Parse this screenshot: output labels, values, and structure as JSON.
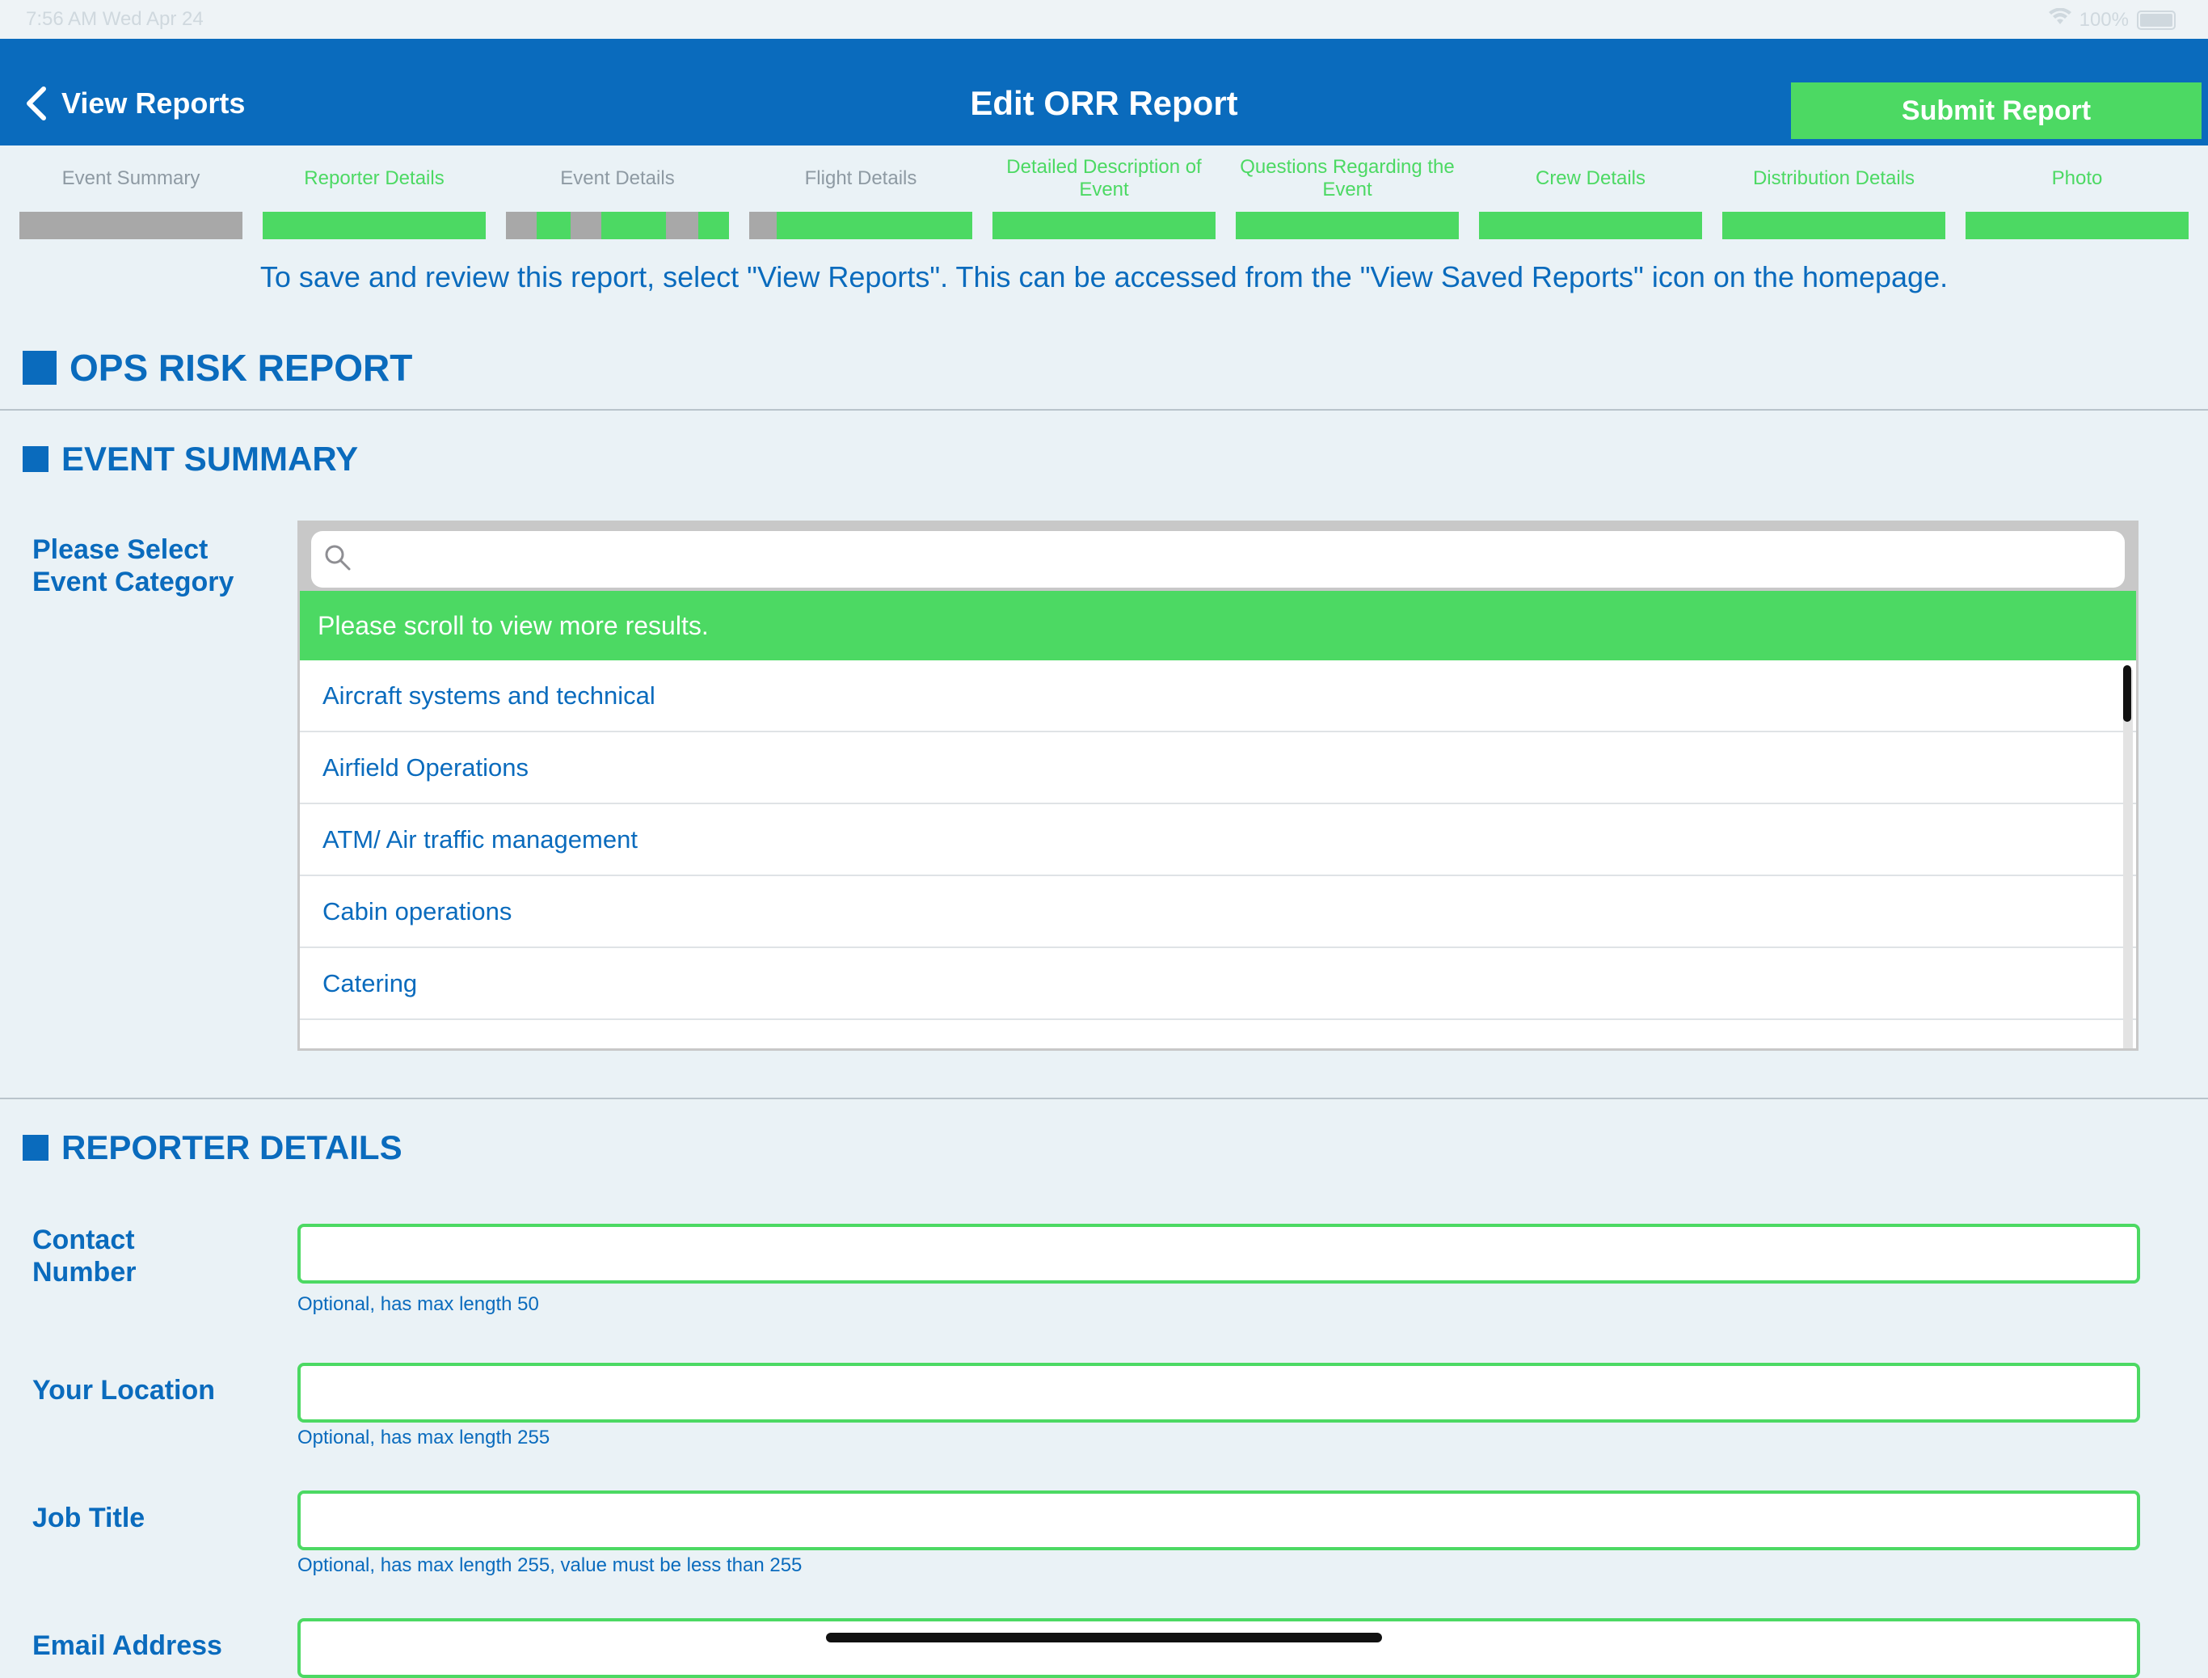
{
  "status_bar": {
    "time": "7:56 AM  Wed Apr 24",
    "battery": "100%"
  },
  "nav": {
    "back_label": "View Reports",
    "title": "Edit ORR Report",
    "submit_label": "Submit Report"
  },
  "steps": [
    {
      "label": "Event Summary",
      "status": "incomplete"
    },
    {
      "label": "Reporter Details",
      "status": "complete"
    },
    {
      "label": "Event Details",
      "status": "partial"
    },
    {
      "label": "Flight Details",
      "status": "partial"
    },
    {
      "label": "Detailed Description of Event",
      "status": "complete"
    },
    {
      "label": "Questions Regarding the Event",
      "status": "complete"
    },
    {
      "label": "Crew Details",
      "status": "complete"
    },
    {
      "label": "Distribution Details",
      "status": "complete"
    },
    {
      "label": "Photo",
      "status": "complete"
    }
  ],
  "notice": "To save and review this report, select \"View Reports\". This can be accessed from the \"View Saved Reports\" icon on the homepage.",
  "report_title": "OPS RISK REPORT",
  "event_summary": {
    "title": "EVENT SUMMARY",
    "category_label": "Please Select Event Category",
    "search_placeholder": "",
    "banner": "Please scroll to view more results.",
    "options": [
      "Aircraft systems and technical",
      "Airfield Operations",
      "ATM/ Air traffic management",
      "Cabin operations",
      "Catering"
    ]
  },
  "reporter_details": {
    "title": "REPORTER DETAILS",
    "fields": [
      {
        "label": "Contact Number",
        "value": "",
        "hint": "Optional, has max length 50"
      },
      {
        "label": "Your Location",
        "value": "",
        "hint": "Optional, has max length 255"
      },
      {
        "label": "Job Title",
        "value": "",
        "hint": "Optional, has max length 255, value must be less than 255"
      },
      {
        "label": "Email Address",
        "value": "",
        "hint": ""
      }
    ]
  },
  "colors": {
    "brand_blue": "#0a6bbd",
    "accent_green": "#4cd963",
    "incomplete_gray": "#a8a8a8",
    "background": "#eaf2f6"
  }
}
